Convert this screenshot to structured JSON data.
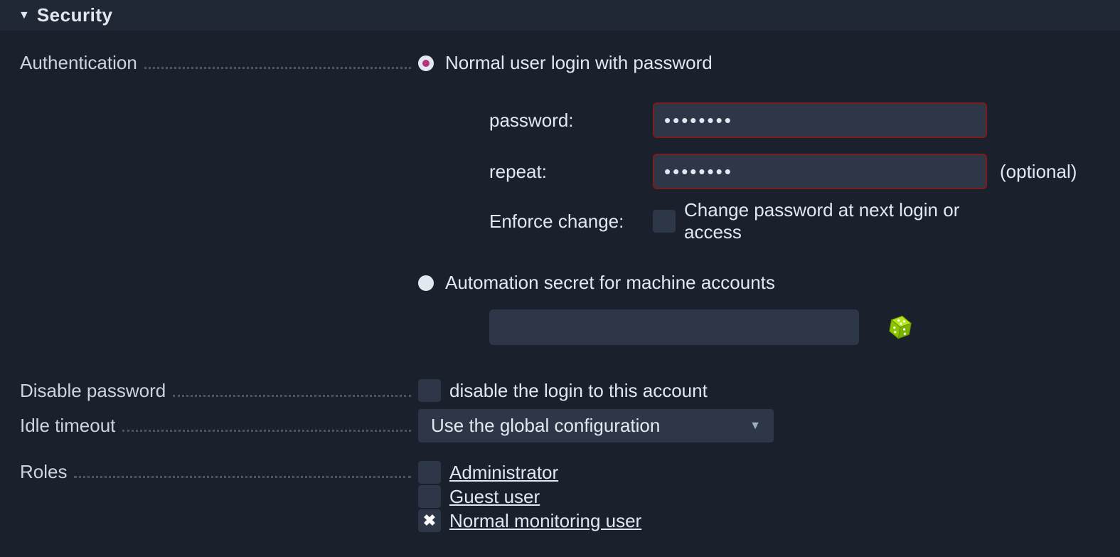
{
  "section": {
    "title": "Security"
  },
  "labels": {
    "authentication": "Authentication",
    "disable_password": "Disable password",
    "idle_timeout": "Idle timeout",
    "roles": "Roles"
  },
  "auth": {
    "radio_normal": "Normal user login with password",
    "radio_automation": "Automation secret for machine accounts",
    "password_label": "password:",
    "repeat_label": "repeat:",
    "enforce_label": "Enforce change:",
    "enforce_text": "Change password at next login or access",
    "optional": "(optional)",
    "password_value": "••••••••",
    "repeat_value": "••••••••",
    "secret_value": ""
  },
  "disable_password_text": "disable the login to this account",
  "idle_timeout_value": "Use the global configuration",
  "roles_list": {
    "admin": "Administrator",
    "guest": "Guest user",
    "normal": "Normal monitoring user"
  }
}
